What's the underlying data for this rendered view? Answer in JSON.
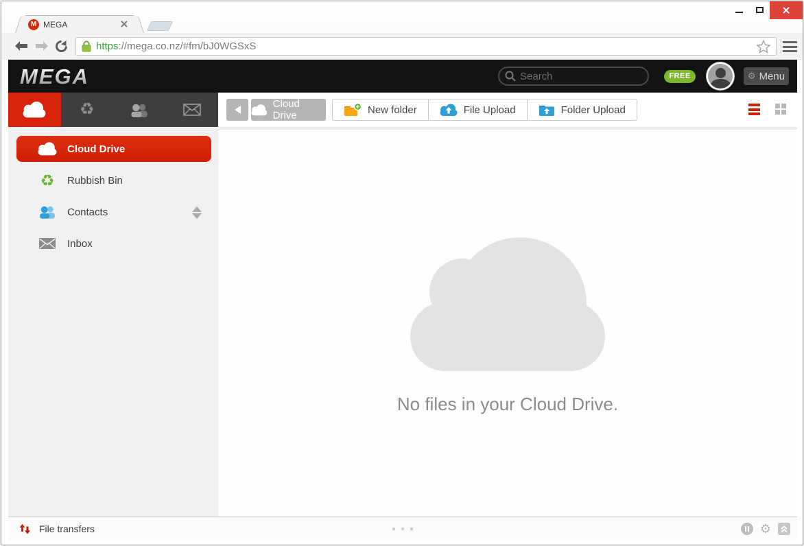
{
  "browser": {
    "tab_title": "MEGA",
    "url": {
      "scheme": "https",
      "rest": "://mega.co.nz/#fm/bJ0WGSxS"
    },
    "favicon_letter": "M"
  },
  "header": {
    "logo": "MEGA",
    "search_placeholder": "Search",
    "plan_badge": "FREE",
    "menu_label": "Menu"
  },
  "sidebar": {
    "items": [
      {
        "label": "Cloud Drive",
        "active": true
      },
      {
        "label": "Rubbish Bin",
        "active": false
      },
      {
        "label": "Contacts",
        "active": false
      },
      {
        "label": "Inbox",
        "active": false
      }
    ]
  },
  "toolbar": {
    "breadcrumb": "Cloud Drive",
    "new_folder": "New folder",
    "file_upload": "File Upload",
    "folder_upload": "Folder Upload"
  },
  "main": {
    "empty_message": "No files in your Cloud Drive."
  },
  "footer": {
    "transfers_label": "File transfers"
  },
  "icons": {
    "recycle_glyph": "♻",
    "gear_glyph": "⚙"
  },
  "colors": {
    "mega_red": "#d8230a",
    "free_green": "#7eb62c",
    "upload_blue": "#2e9fd9",
    "folder_orange": "#f7a416",
    "recycle_green": "#67b32e",
    "cloud_gray": "#e3e3e5"
  }
}
